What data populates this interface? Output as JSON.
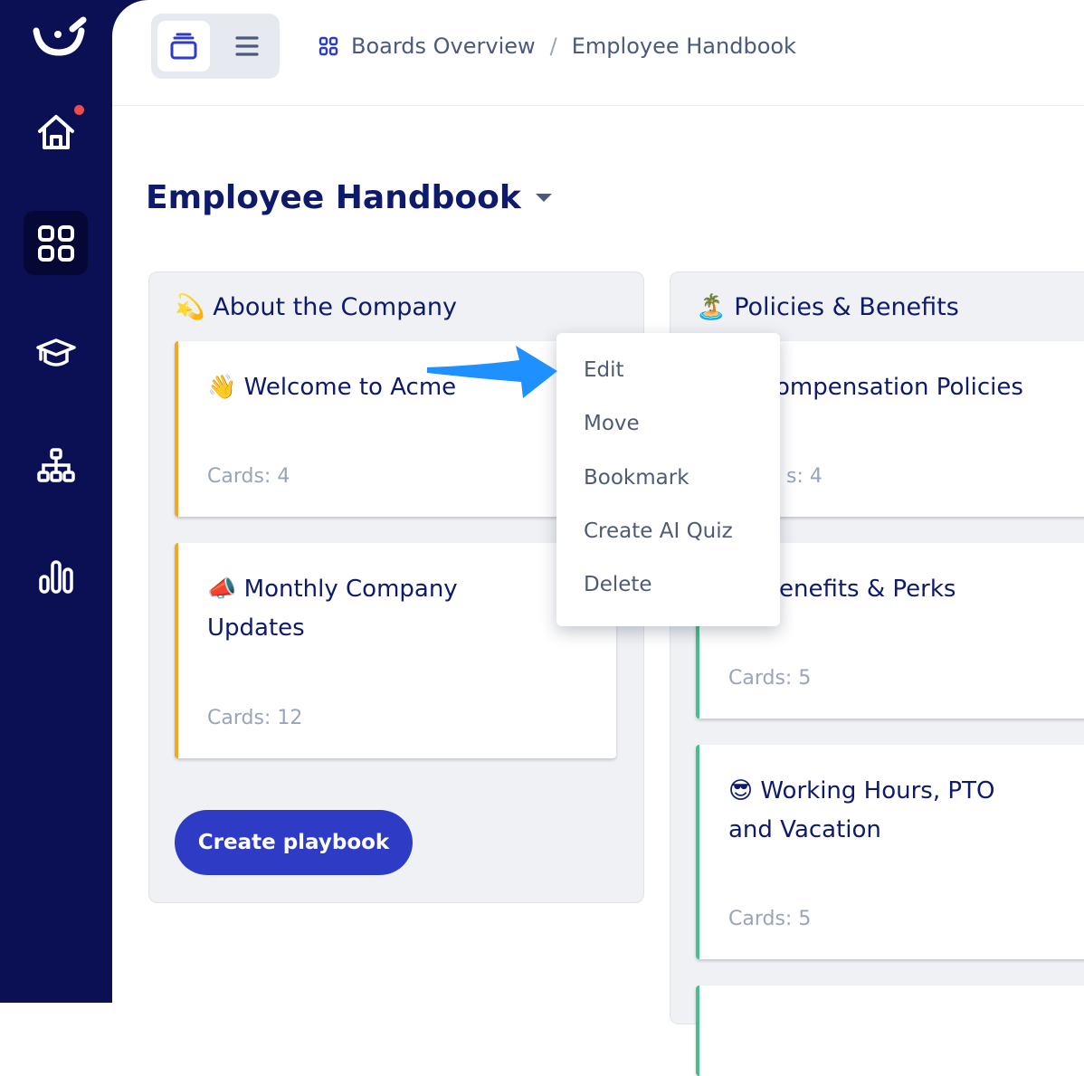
{
  "breadcrumb": {
    "root": "Boards Overview",
    "separator": "/",
    "current": "Employee Handbook"
  },
  "board": {
    "title": "Employee Handbook"
  },
  "columns": [
    {
      "emoji": "💫",
      "title": "About the Company",
      "cards": [
        {
          "emoji": "👋",
          "title": "Welcome to Acme",
          "count": "Cards: 4"
        },
        {
          "emoji": "📣",
          "title": "Monthly Company Updates",
          "count": "Cards: 12"
        }
      ]
    },
    {
      "emoji": "🏝️",
      "title": "Policies & Benefits",
      "cards": [
        {
          "title": "ompensation Policies",
          "count": "s: 4"
        },
        {
          "title": "enefits & Perks",
          "count": "Cards: 5"
        },
        {
          "emoji": "😎",
          "title": "Working Hours, PTO and Vacation",
          "count": "Cards: 5"
        }
      ]
    }
  ],
  "create_button": "Create playbook",
  "context_menu": [
    "Edit",
    "Move",
    "Bookmark",
    "Create AI Quiz",
    "Delete"
  ],
  "colors": {
    "sidebar": "#0b1054",
    "accent": "#2e3bc4",
    "card_orange": "#f5a623",
    "card_green": "#45c08a",
    "arrow": "#1e90ff"
  },
  "icons": [
    "logo-icon",
    "home-icon",
    "boards-icon",
    "graduation-cap-icon",
    "org-chart-icon",
    "analytics-icon",
    "card-view-icon",
    "list-view-icon",
    "grid-icon",
    "arrow-pointer-icon"
  ]
}
